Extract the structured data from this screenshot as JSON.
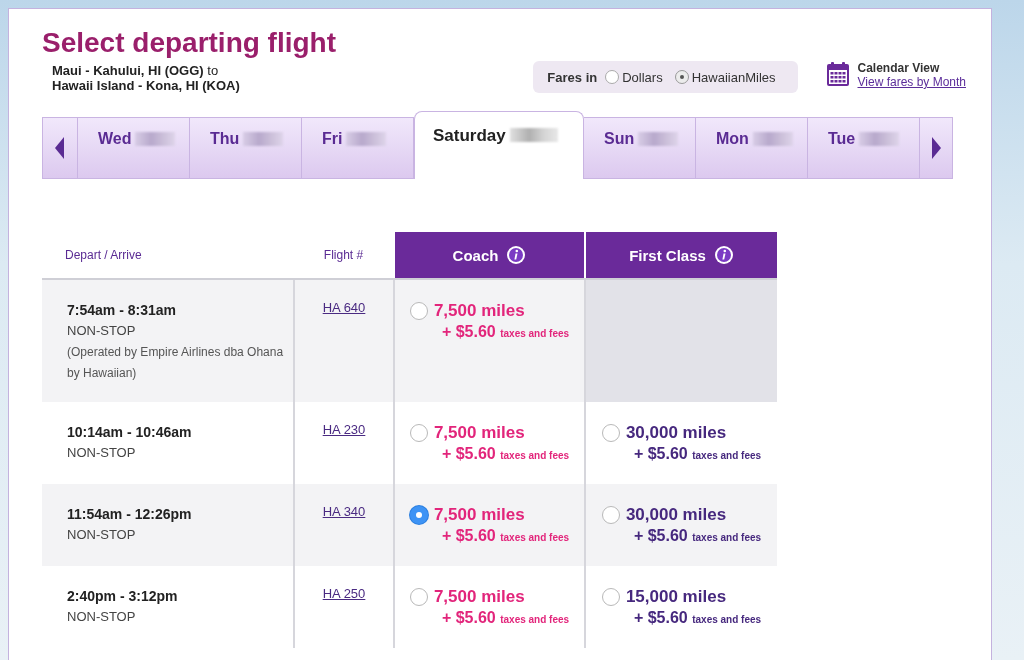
{
  "title": "Select departing flight",
  "route": [
    "**Maui - Kahului, HI (OGG)** to",
    "**Hawaii Island - Kona, HI (KOA)**"
  ],
  "fares_in": {
    "label": "Fares in",
    "options": [
      {
        "label": "Dollars",
        "selected": false
      },
      {
        "label": "HawaiianMiles",
        "selected": true
      }
    ]
  },
  "calendar": {
    "title": "Calendar View",
    "link": "View fares by Month"
  },
  "date_tabs": [
    {
      "label": "Wed",
      "selected": false
    },
    {
      "label": "Thu",
      "selected": false
    },
    {
      "label": "Fri",
      "selected": false
    },
    {
      "label": "Saturday",
      "selected": true
    },
    {
      "label": "Sun",
      "selected": false
    },
    {
      "label": "Mon",
      "selected": false
    },
    {
      "label": "Tue",
      "selected": false
    }
  ],
  "table": {
    "columns": [
      "Depart / Arrive",
      "Flight #",
      "Coach",
      "First Class"
    ],
    "rows": [
      {
        "time": "7:54am - 8:31am",
        "stops": "NON-STOP",
        "note": "(Operated by Empire Airlines dba Ohana by Hawaiian)",
        "flight": "HA 640",
        "coach": {
          "miles": "7,500 miles",
          "fee": "+ $5.60",
          "fee_note": "taxes and fees",
          "selected": false
        }
      },
      {
        "time": "10:14am - 10:46am",
        "stops": "NON-STOP",
        "flight": "HA 230",
        "coach": {
          "miles": "7,500 miles",
          "fee": "+ $5.60",
          "fee_note": "taxes and fees",
          "selected": false
        },
        "first": {
          "miles": "30,000 miles",
          "fee": "+ $5.60",
          "fee_note": "taxes and fees",
          "selected": false
        }
      },
      {
        "time": "11:54am - 12:26pm",
        "stops": "NON-STOP",
        "flight": "HA 340",
        "coach": {
          "miles": "7,500 miles",
          "fee": "+ $5.60",
          "fee_note": "taxes and fees",
          "selected": true
        },
        "first": {
          "miles": "30,000 miles",
          "fee": "+ $5.60",
          "fee_note": "taxes and fees",
          "selected": false
        }
      },
      {
        "time": "2:40pm - 3:12pm",
        "stops": "NON-STOP",
        "flight": "HA 250",
        "coach": {
          "miles": "7,500 miles",
          "fee": "+ $5.60",
          "fee_note": "taxes and fees",
          "selected": false
        },
        "first": {
          "miles": "15,000 miles",
          "fee": "+ $5.60",
          "fee_note": "taxes and fees",
          "selected": false
        }
      }
    ]
  }
}
